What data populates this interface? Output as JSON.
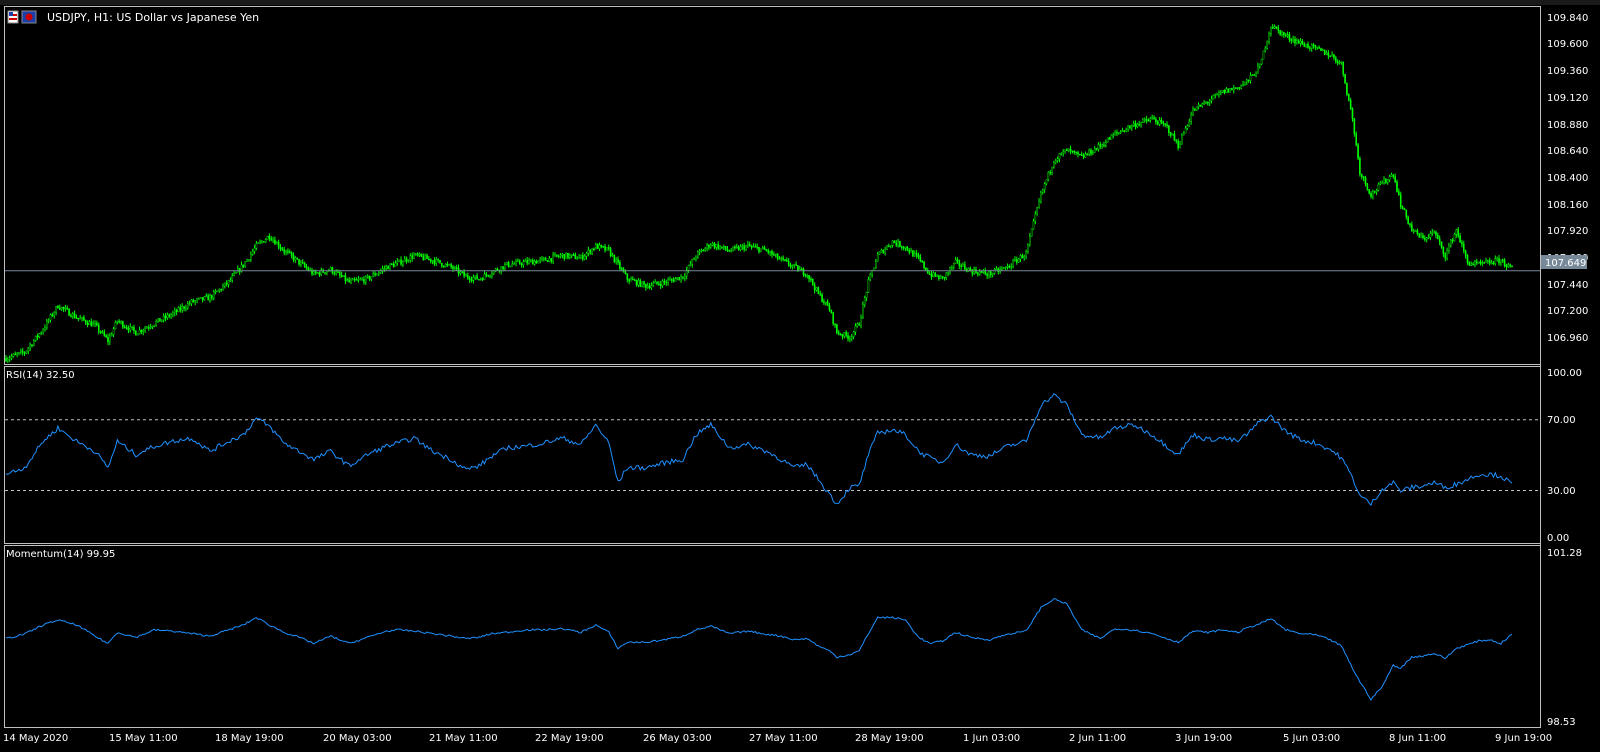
{
  "window": {
    "title": "USDJPY, H1:  US Dollar vs Japanese Yen"
  },
  "colors": {
    "background": "#000000",
    "candle": "#00ff00",
    "rsi_line": "#1e90ff",
    "momentum_line": "#1e90ff",
    "bid_line": "#778899",
    "text": "#ffffff",
    "panel_border": "#c0c0c0"
  },
  "chart_data": [
    {
      "type": "candlestick",
      "title": "USDJPY, H1:  US Dollar vs Japanese Yen",
      "ylim": [
        106.85,
        109.9
      ],
      "yticks": [
        "109.840",
        "109.600",
        "109.360",
        "109.120",
        "108.880",
        "108.640",
        "108.400",
        "108.160",
        "107.920",
        "107.680",
        "107.440",
        "107.200",
        "106.960"
      ],
      "current_price": "107.649",
      "close_path": [
        [
          0,
          106.9
        ],
        [
          10,
          106.95
        ],
        [
          20,
          107.15
        ],
        [
          28,
          107.35
        ],
        [
          38,
          107.25
        ],
        [
          48,
          107.18
        ],
        [
          55,
          107.05
        ],
        [
          60,
          107.22
        ],
        [
          70,
          107.12
        ],
        [
          80,
          107.2
        ],
        [
          90,
          107.28
        ],
        [
          100,
          107.38
        ],
        [
          110,
          107.42
        ],
        [
          120,
          107.55
        ],
        [
          128,
          107.7
        ],
        [
          135,
          107.86
        ],
        [
          142,
          107.95
        ],
        [
          150,
          107.82
        ],
        [
          158,
          107.72
        ],
        [
          166,
          107.62
        ],
        [
          175,
          107.66
        ],
        [
          185,
          107.55
        ],
        [
          195,
          107.58
        ],
        [
          205,
          107.68
        ],
        [
          212,
          107.72
        ],
        [
          220,
          107.78
        ],
        [
          230,
          107.74
        ],
        [
          240,
          107.68
        ],
        [
          248,
          107.6
        ],
        [
          255,
          107.58
        ],
        [
          262,
          107.64
        ],
        [
          270,
          107.7
        ],
        [
          280,
          107.72
        ],
        [
          290,
          107.74
        ],
        [
          300,
          107.78
        ],
        [
          310,
          107.76
        ],
        [
          318,
          107.86
        ],
        [
          325,
          107.82
        ],
        [
          330,
          107.7
        ],
        [
          335,
          107.58
        ],
        [
          345,
          107.52
        ],
        [
          355,
          107.55
        ],
        [
          365,
          107.6
        ],
        [
          372,
          107.78
        ],
        [
          380,
          107.88
        ],
        [
          390,
          107.82
        ],
        [
          400,
          107.86
        ],
        [
          410,
          107.82
        ],
        [
          418,
          107.74
        ],
        [
          425,
          107.68
        ],
        [
          432,
          107.62
        ],
        [
          438,
          107.45
        ],
        [
          444,
          107.32
        ],
        [
          448,
          107.12
        ],
        [
          455,
          107.08
        ],
        [
          460,
          107.2
        ],
        [
          465,
          107.55
        ],
        [
          470,
          107.78
        ],
        [
          478,
          107.9
        ],
        [
          485,
          107.85
        ],
        [
          492,
          107.75
        ],
        [
          498,
          107.62
        ],
        [
          505,
          107.58
        ],
        [
          512,
          107.72
        ],
        [
          520,
          107.65
        ],
        [
          530,
          107.62
        ],
        [
          540,
          107.68
        ],
        [
          550,
          107.8
        ],
        [
          558,
          108.3
        ],
        [
          565,
          108.6
        ],
        [
          572,
          108.68
        ],
        [
          580,
          108.62
        ],
        [
          590,
          108.72
        ],
        [
          598,
          108.82
        ],
        [
          608,
          108.9
        ],
        [
          618,
          108.95
        ],
        [
          626,
          108.88
        ],
        [
          632,
          108.72
        ],
        [
          640,
          109.02
        ],
        [
          648,
          109.1
        ],
        [
          656,
          109.18
        ],
        [
          664,
          109.22
        ],
        [
          670,
          109.28
        ],
        [
          676,
          109.4
        ],
        [
          682,
          109.75
        ],
        [
          690,
          109.66
        ],
        [
          698,
          109.6
        ],
        [
          706,
          109.55
        ],
        [
          714,
          109.5
        ],
        [
          720,
          109.42
        ],
        [
          726,
          108.95
        ],
        [
          730,
          108.5
        ],
        [
          736,
          108.3
        ],
        [
          742,
          108.4
        ],
        [
          748,
          108.48
        ],
        [
          752,
          108.22
        ],
        [
          758,
          108.0
        ],
        [
          764,
          107.92
        ],
        [
          770,
          107.98
        ],
        [
          776,
          107.78
        ],
        [
          782,
          108.0
        ],
        [
          788,
          107.72
        ],
        [
          794,
          107.7
        ],
        [
          800,
          107.72
        ],
        [
          806,
          107.74
        ],
        [
          812,
          107.66
        ]
      ]
    },
    {
      "type": "line",
      "title": "RSI(14) 32.50",
      "ylim": [
        0,
        100
      ],
      "yticks": [
        "100.00",
        "70.00",
        "30.00",
        "0.00"
      ],
      "levels": [
        70,
        30
      ],
      "points": [
        [
          0,
          38
        ],
        [
          10,
          42
        ],
        [
          20,
          58
        ],
        [
          28,
          66
        ],
        [
          38,
          58
        ],
        [
          48,
          52
        ],
        [
          55,
          42
        ],
        [
          60,
          58
        ],
        [
          70,
          50
        ],
        [
          80,
          55
        ],
        [
          90,
          58
        ],
        [
          100,
          60
        ],
        [
          110,
          52
        ],
        [
          120,
          58
        ],
        [
          128,
          62
        ],
        [
          135,
          72
        ],
        [
          142,
          67
        ],
        [
          150,
          57
        ],
        [
          158,
          52
        ],
        [
          166,
          47
        ],
        [
          175,
          52
        ],
        [
          185,
          43
        ],
        [
          195,
          50
        ],
        [
          205,
          55
        ],
        [
          212,
          57
        ],
        [
          220,
          60
        ],
        [
          230,
          52
        ],
        [
          240,
          47
        ],
        [
          248,
          41
        ],
        [
          255,
          43
        ],
        [
          262,
          49
        ],
        [
          270,
          54
        ],
        [
          280,
          55
        ],
        [
          290,
          57
        ],
        [
          300,
          60
        ],
        [
          310,
          56
        ],
        [
          318,
          68
        ],
        [
          325,
          57
        ],
        [
          330,
          33
        ],
        [
          335,
          42
        ],
        [
          345,
          42
        ],
        [
          355,
          45
        ],
        [
          365,
          47
        ],
        [
          372,
          62
        ],
        [
          380,
          68
        ],
        [
          390,
          54
        ],
        [
          400,
          56
        ],
        [
          410,
          52
        ],
        [
          418,
          47
        ],
        [
          425,
          42
        ],
        [
          432,
          44
        ],
        [
          438,
          35
        ],
        [
          444,
          26
        ],
        [
          448,
          20
        ],
        [
          455,
          30
        ],
        [
          460,
          31
        ],
        [
          465,
          50
        ],
        [
          470,
          63
        ],
        [
          478,
          65
        ],
        [
          485,
          62
        ],
        [
          492,
          52
        ],
        [
          498,
          48
        ],
        [
          505,
          45
        ],
        [
          512,
          56
        ],
        [
          520,
          50
        ],
        [
          530,
          49
        ],
        [
          540,
          55
        ],
        [
          550,
          58
        ],
        [
          558,
          80
        ],
        [
          565,
          86
        ],
        [
          572,
          80
        ],
        [
          580,
          62
        ],
        [
          590,
          60
        ],
        [
          598,
          66
        ],
        [
          608,
          68
        ],
        [
          618,
          62
        ],
        [
          626,
          55
        ],
        [
          632,
          50
        ],
        [
          640,
          62
        ],
        [
          648,
          59
        ],
        [
          656,
          60
        ],
        [
          664,
          58
        ],
        [
          670,
          63
        ],
        [
          676,
          70
        ],
        [
          682,
          73
        ],
        [
          690,
          64
        ],
        [
          698,
          59
        ],
        [
          706,
          57
        ],
        [
          714,
          53
        ],
        [
          720,
          48
        ],
        [
          726,
          36
        ],
        [
          730,
          25
        ],
        [
          736,
          20
        ],
        [
          742,
          29
        ],
        [
          748,
          33
        ],
        [
          752,
          28
        ],
        [
          758,
          30
        ],
        [
          764,
          31
        ],
        [
          770,
          33
        ],
        [
          776,
          30
        ],
        [
          782,
          32
        ],
        [
          788,
          35
        ],
        [
          794,
          38
        ],
        [
          800,
          38
        ],
        [
          806,
          37
        ],
        [
          812,
          32
        ]
      ]
    },
    {
      "type": "line",
      "title": "Momentum(14) 99.95",
      "ylim": [
        98.53,
        101.28
      ],
      "yticks": [
        "101.28",
        "98.53"
      ],
      "points": [
        [
          0,
          99.88
        ],
        [
          10,
          99.95
        ],
        [
          20,
          100.1
        ],
        [
          28,
          100.18
        ],
        [
          38,
          100.1
        ],
        [
          48,
          99.92
        ],
        [
          55,
          99.8
        ],
        [
          60,
          99.98
        ],
        [
          70,
          99.9
        ],
        [
          80,
          100.02
        ],
        [
          90,
          100.0
        ],
        [
          100,
          99.96
        ],
        [
          110,
          99.92
        ],
        [
          120,
          100.02
        ],
        [
          128,
          100.1
        ],
        [
          135,
          100.22
        ],
        [
          142,
          100.1
        ],
        [
          150,
          99.98
        ],
        [
          158,
          99.9
        ],
        [
          166,
          99.8
        ],
        [
          175,
          99.92
        ],
        [
          185,
          99.8
        ],
        [
          195,
          99.9
        ],
        [
          205,
          100.0
        ],
        [
          212,
          100.02
        ],
        [
          220,
          100.0
        ],
        [
          230,
          99.96
        ],
        [
          240,
          99.92
        ],
        [
          248,
          99.88
        ],
        [
          255,
          99.9
        ],
        [
          262,
          99.96
        ],
        [
          270,
          99.98
        ],
        [
          280,
          100.02
        ],
        [
          290,
          100.02
        ],
        [
          300,
          100.04
        ],
        [
          310,
          99.98
        ],
        [
          318,
          100.1
        ],
        [
          325,
          99.98
        ],
        [
          330,
          99.72
        ],
        [
          335,
          99.82
        ],
        [
          345,
          99.82
        ],
        [
          355,
          99.86
        ],
        [
          365,
          99.92
        ],
        [
          372,
          100.02
        ],
        [
          380,
          100.08
        ],
        [
          390,
          99.96
        ],
        [
          400,
          100.0
        ],
        [
          410,
          99.95
        ],
        [
          418,
          99.92
        ],
        [
          425,
          99.86
        ],
        [
          432,
          99.88
        ],
        [
          438,
          99.76
        ],
        [
          444,
          99.68
        ],
        [
          448,
          99.58
        ],
        [
          455,
          99.62
        ],
        [
          460,
          99.68
        ],
        [
          465,
          99.96
        ],
        [
          470,
          100.22
        ],
        [
          478,
          100.22
        ],
        [
          485,
          100.18
        ],
        [
          492,
          99.9
        ],
        [
          498,
          99.8
        ],
        [
          505,
          99.84
        ],
        [
          512,
          99.98
        ],
        [
          520,
          99.9
        ],
        [
          530,
          99.86
        ],
        [
          540,
          99.95
        ],
        [
          550,
          100.0
        ],
        [
          558,
          100.38
        ],
        [
          565,
          100.52
        ],
        [
          572,
          100.44
        ],
        [
          580,
          100.02
        ],
        [
          590,
          99.88
        ],
        [
          598,
          100.04
        ],
        [
          608,
          100.02
        ],
        [
          618,
          99.96
        ],
        [
          626,
          99.88
        ],
        [
          632,
          99.82
        ],
        [
          640,
          100.0
        ],
        [
          648,
          99.98
        ],
        [
          656,
          100.02
        ],
        [
          664,
          99.98
        ],
        [
          670,
          100.06
        ],
        [
          676,
          100.12
        ],
        [
          682,
          100.2
        ],
        [
          690,
          100.02
        ],
        [
          698,
          99.96
        ],
        [
          706,
          99.94
        ],
        [
          714,
          99.86
        ],
        [
          720,
          99.76
        ],
        [
          726,
          99.4
        ],
        [
          730,
          99.18
        ],
        [
          736,
          98.9
        ],
        [
          742,
          99.1
        ],
        [
          748,
          99.45
        ],
        [
          752,
          99.4
        ],
        [
          758,
          99.58
        ],
        [
          764,
          99.6
        ],
        [
          770,
          99.64
        ],
        [
          776,
          99.56
        ],
        [
          782,
          99.72
        ],
        [
          788,
          99.78
        ],
        [
          794,
          99.84
        ],
        [
          800,
          99.86
        ],
        [
          806,
          99.8
        ],
        [
          812,
          99.95
        ]
      ]
    }
  ],
  "time_axis": {
    "labels": [
      "14 May 2020",
      "15 May 11:00",
      "18 May 19:00",
      "20 May 03:00",
      "21 May 11:00",
      "22 May 19:00",
      "26 May 03:00",
      "27 May 11:00",
      "28 May 19:00",
      "1 Jun 03:00",
      "2 Jun 11:00",
      "3 Jun 19:00",
      "5 Jun 03:00",
      "8 Jun 11:00",
      "9 Jun 19:00"
    ]
  }
}
